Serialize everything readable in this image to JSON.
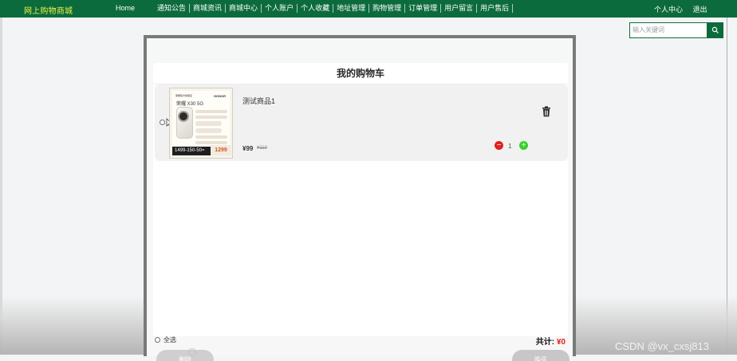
{
  "header": {
    "brand": "网上购物商城",
    "nav": [
      "Home",
      "通知公告",
      "商城资讯",
      "商城中心",
      "个人账户",
      "个人收藏",
      "地址管理",
      "购物管理",
      "订单管理",
      "用户留言",
      "用户售后"
    ],
    "user_links": [
      "个人中心",
      "退出"
    ],
    "search_placeholder": "输入关键词",
    "brand_color": "#0c6b3c",
    "accent_color": "#e7f04a",
    "search_icon": "search-icon"
  },
  "cart": {
    "title": "我的购物车",
    "items": [
      {
        "name": "测试商品1",
        "price": "¥99",
        "old_price": "¥110",
        "quantity": "1",
        "image": {
          "brand": "HONOR",
          "model": "荣耀 X30 5G",
          "promo": "1499-150-50=",
          "sale_price": "1299"
        }
      }
    ],
    "select_all_label": "全选",
    "total_label": "共计:",
    "total_value": "¥0",
    "delete_label": "删除",
    "buy_label": "购买"
  },
  "watermark": "CSDN @vx_cxsj813"
}
